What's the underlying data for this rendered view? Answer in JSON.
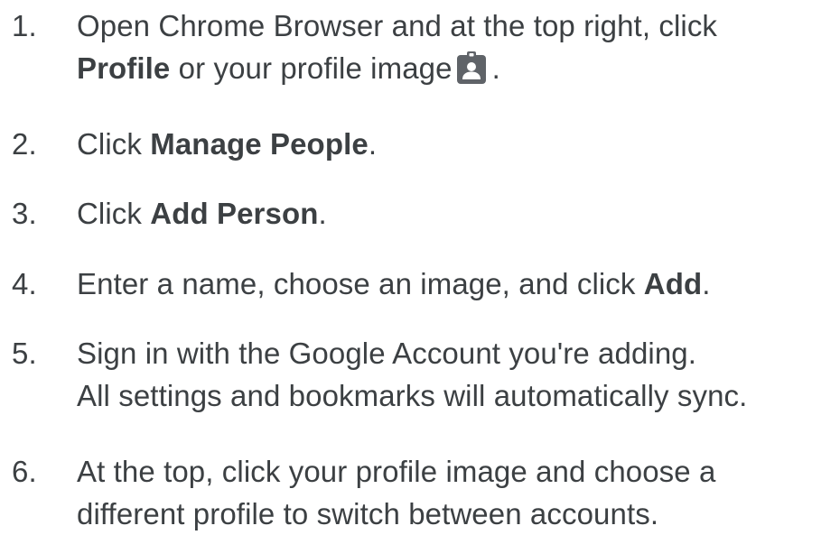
{
  "steps": [
    {
      "number": "1.",
      "line1": "Open Chrome Browser and at the top right, click",
      "line2_bold": "Profile",
      "line2_text": " or your profile image",
      "line2_end": ".",
      "icon": "profile-badge-icon"
    },
    {
      "number": "2.",
      "pre": "Click ",
      "bold": "Manage People",
      "post": "."
    },
    {
      "number": "3.",
      "pre": "Click ",
      "bold": "Add Person",
      "post": "."
    },
    {
      "number": "4.",
      "pre": "Enter a name, choose an image, and click ",
      "bold": "Add",
      "post": "."
    },
    {
      "number": "5.",
      "line1": "Sign in with the Google Account you're adding.",
      "line2": "All settings and bookmarks will automatically sync."
    },
    {
      "number": "6.",
      "line1": "At the top, click your profile image and choose a",
      "line2": "different profile to switch between accounts."
    }
  ],
  "colors": {
    "text": "#3c4043",
    "icon": "#5f6368"
  }
}
